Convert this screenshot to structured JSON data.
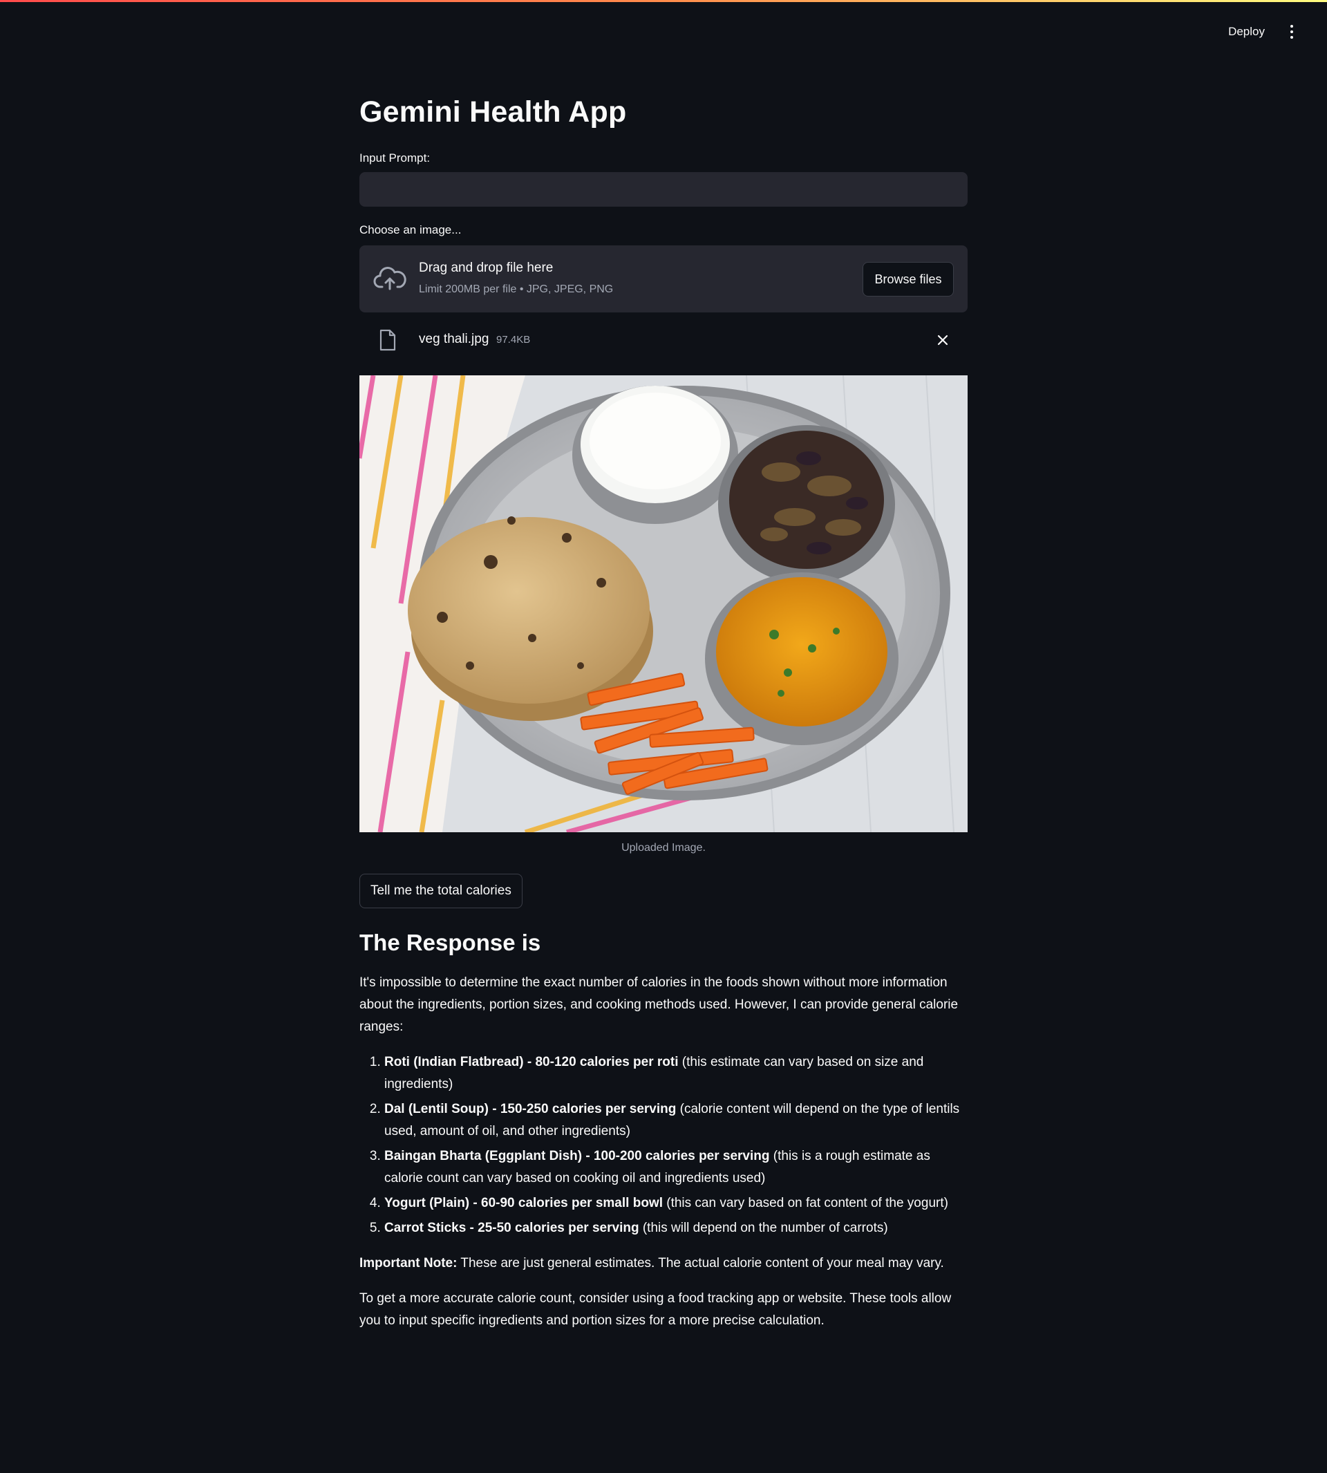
{
  "header": {
    "deploy_label": "Deploy",
    "menu_icon": "kebab-menu-icon"
  },
  "app": {
    "title": "Gemini Health App"
  },
  "prompt": {
    "label": "Input Prompt:",
    "value": "",
    "placeholder": ""
  },
  "uploader": {
    "label": "Choose an image...",
    "drag_title": "Drag and drop file here",
    "limit_text": "Limit 200MB per file • JPG, JPEG, PNG",
    "browse_label": "Browse files",
    "icon": "cloud-upload-icon"
  },
  "file": {
    "name": "veg thali.jpg",
    "size": "97.4KB",
    "icon": "file-icon",
    "remove_icon": "close-icon"
  },
  "image": {
    "caption": "Uploaded Image."
  },
  "action": {
    "button_label": "Tell me the total calories"
  },
  "response": {
    "title": "The Response is",
    "intro": "It's impossible to determine the exact number of calories in the foods shown without more information about the ingredients, portion sizes, and cooking methods used. However, I can provide general calorie ranges:",
    "items": [
      {
        "bold": "Roti (Indian Flatbread) - 80-120 calories per roti",
        "rest": " (this estimate can vary based on size and ingredients)"
      },
      {
        "bold": "Dal (Lentil Soup) - 150-250 calories per serving",
        "rest": " (calorie content will depend on the type of lentils used, amount of oil, and other ingredients)"
      },
      {
        "bold": "Baingan Bharta (Eggplant Dish) - 100-200 calories per serving",
        "rest": " (this is a rough estimate as calorie count can vary based on cooking oil and ingredients used)"
      },
      {
        "bold": "Yogurt (Plain) - 60-90 calories per small bowl",
        "rest": " (this can vary based on fat content of the yogurt)"
      },
      {
        "bold": "Carrot Sticks - 25-50 calories per serving",
        "rest": " (this will depend on the number of carrots)"
      }
    ],
    "note_bold": "Important Note:",
    "note_rest": " These are just general estimates. The actual calorie content of your meal may vary.",
    "closing": "To get a more accurate calorie count, consider using a food tracking app or website. These tools allow you to input specific ingredients and portion sizes for a more precise calculation."
  },
  "colors": {
    "background": "#0e1117",
    "surface": "#262730",
    "accent": "#ff4b4b",
    "muted_text": "#a3a8b4"
  }
}
